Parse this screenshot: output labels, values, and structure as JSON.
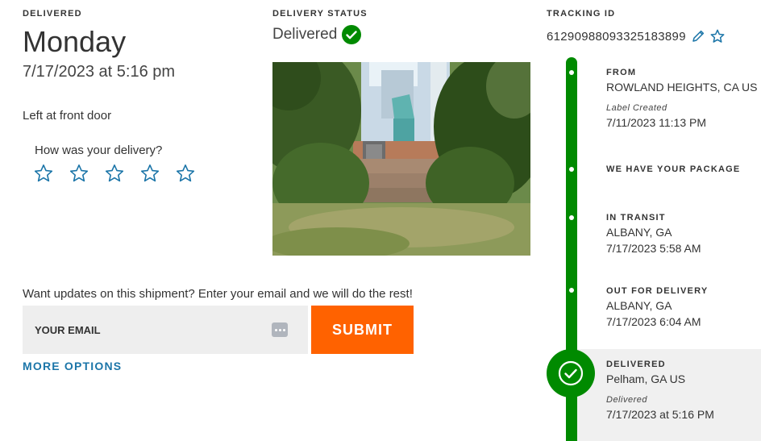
{
  "delivered": {
    "label": "DELIVERED",
    "day": "Monday",
    "datetime": "7/17/2023 at 5:16 pm",
    "left_at": "Left at front door",
    "rating_prompt": "How was your delivery?",
    "rating_stars": 5,
    "rating_value": 0
  },
  "status": {
    "label": "DELIVERY STATUS",
    "text": "Delivered",
    "icon": "check-circle-icon",
    "color": "#008a00"
  },
  "tracking": {
    "label": "TRACKING ID",
    "number": "61290988093325183899",
    "edit_icon": "pencil-icon",
    "favorite_icon": "star-outline-icon"
  },
  "email": {
    "prompt": "Want updates on this shipment? Enter your email and we will do the rest!",
    "placeholder": "YOUR EMAIL",
    "submit_label": "SUBMIT",
    "more_options": "MORE OPTIONS",
    "submit_color": "#ff6200",
    "link_color": "#1b75a8"
  },
  "timeline": [
    {
      "title": "FROM",
      "lines": [
        "ROWLAND HEIGHTS, CA US"
      ],
      "note": "Label Created",
      "note_date": "7/11/2023 11:13 PM"
    },
    {
      "title": "WE HAVE YOUR PACKAGE",
      "lines": []
    },
    {
      "title": "IN TRANSIT",
      "lines": [
        "ALBANY, GA",
        "7/17/2023 5:58 AM"
      ]
    },
    {
      "title": "OUT FOR DELIVERY",
      "lines": [
        "ALBANY, GA",
        "7/17/2023 6:04 AM"
      ]
    },
    {
      "title": "DELIVERED",
      "lines": [
        "Pelham, GA US"
      ],
      "note": "Delivered",
      "note_date": "7/17/2023 at 5:16 PM"
    }
  ]
}
